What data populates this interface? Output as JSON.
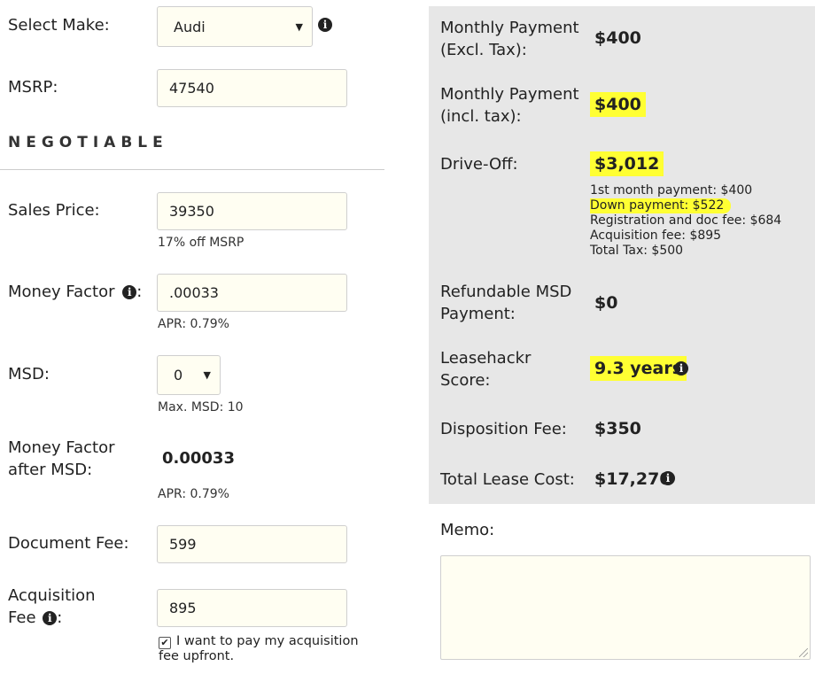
{
  "left": {
    "make": {
      "label": "Select Make:",
      "value": "Audi"
    },
    "msrp": {
      "label": "MSRP:",
      "value": "47540"
    },
    "section_title": "NEGOTIABLE",
    "sales_price": {
      "label": "Sales Price:",
      "value": "39350",
      "note": "17% off MSRP"
    },
    "money_factor": {
      "label": "Money Factor",
      "colon": ":",
      "value": ".00033",
      "note": "APR: 0.79%"
    },
    "msd": {
      "label": "MSD:",
      "value": "0",
      "note": "Max. MSD: 10"
    },
    "mf_after_msd": {
      "label_line1": "Money Factor",
      "label_line2": "after MSD:",
      "value": "0.00033",
      "note": "APR: 0.79%"
    },
    "document_fee": {
      "label": "Document Fee:",
      "value": "599"
    },
    "acquisition_fee": {
      "label_line1": "Acquisition",
      "label_line2": "Fee",
      "colon": ":",
      "value": "895",
      "checkbox_text_line1": "I want to pay my acquisition",
      "checkbox_text_line2": "fee upfront.",
      "checked": true
    }
  },
  "right": {
    "monthly_excl": {
      "label_line1": "Monthly Payment",
      "label_line2": "(Excl. Tax):",
      "value": "$400"
    },
    "monthly_incl": {
      "label_line1": "Monthly Payment",
      "label_line2": "(incl. tax):",
      "value": "$400"
    },
    "drive_off": {
      "label": "Drive-Off:",
      "value": "$3,012",
      "breakdown": [
        "1st month payment: $400",
        "Down payment: $522",
        "Registration and doc fee: $684",
        "Acquisition fee: $895",
        "Total Tax: $500"
      ]
    },
    "refundable_msd": {
      "label_line1": "Refundable MSD",
      "label_line2": "Payment:",
      "value": "$0"
    },
    "score": {
      "label_line1": "Leasehackr",
      "label_line2": "Score:",
      "value": "9.3 years"
    },
    "disposition": {
      "label": "Disposition Fee:",
      "value": "$350"
    },
    "total_cost": {
      "label": "Total Lease Cost:",
      "value": "$17,270"
    },
    "memo_label": "Memo:"
  },
  "colors": {
    "highlight": "#ffff33",
    "panel_bg": "#e7e7e7",
    "input_bg": "#fffef2"
  },
  "icons": [
    "info-icon",
    "chevron-down-icon",
    "checkmark-icon",
    "resize-grip-icon"
  ]
}
